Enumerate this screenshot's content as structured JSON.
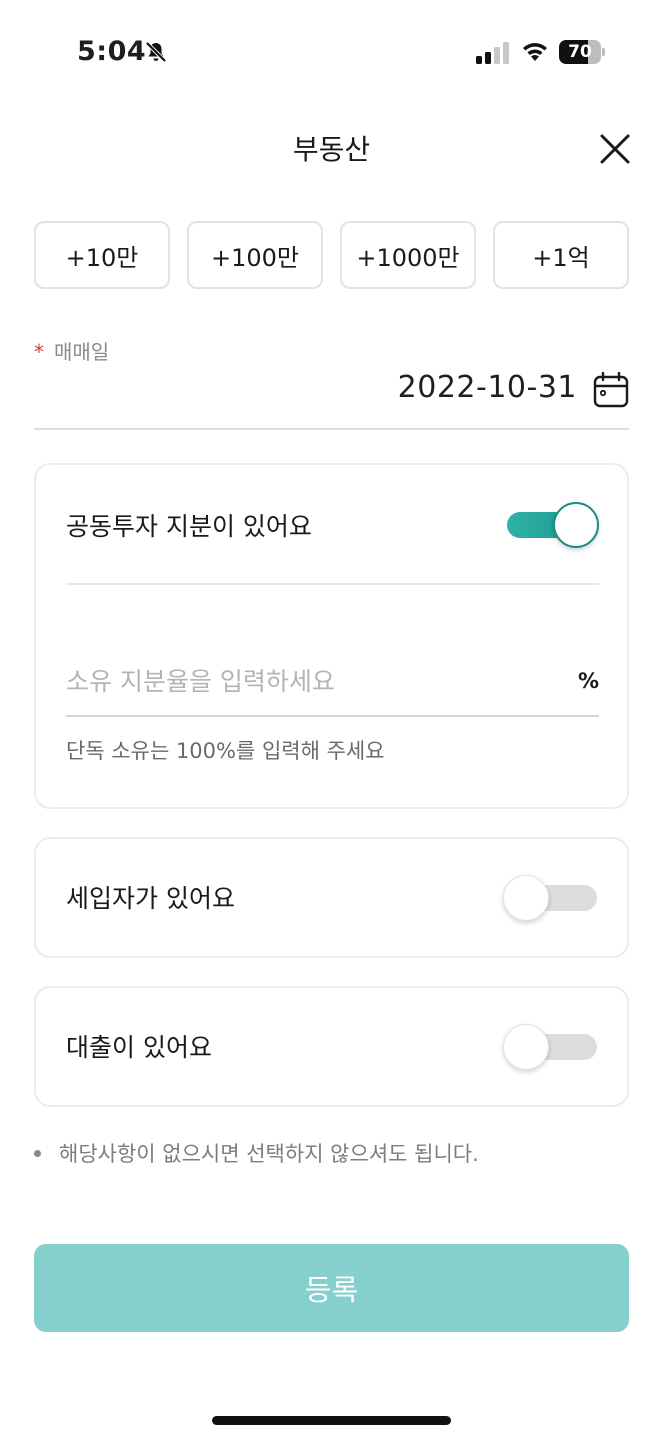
{
  "status_bar": {
    "time": "5:04",
    "battery_level": "70",
    "battery_fraction": 0.7,
    "icons": [
      "bell-slash-icon",
      "signal-icon",
      "wifi-icon",
      "battery-icon"
    ]
  },
  "header": {
    "title": "부동산",
    "close_icon": "close-icon"
  },
  "quick_amounts": [
    "+10만",
    "+100만",
    "+1000만",
    "+1억"
  ],
  "sale_date": {
    "required_mark": "*",
    "label": "매매일",
    "value": "2022-10-31",
    "icon": "calendar-icon"
  },
  "joint_investment": {
    "label": "공동투자 지분이 있어요",
    "enabled": true,
    "share_input": {
      "placeholder": "소유 지분율을 입력하세요",
      "value": "",
      "suffix": "%"
    },
    "helper_text": "단독 소유는 100%를 입력해 주세요"
  },
  "tenant": {
    "label": "세입자가 있어요",
    "enabled": false
  },
  "loan": {
    "label": "대출이 있어요",
    "enabled": false
  },
  "note": "해당사항이 없으시면 선택하지 않으셔도 됩니다.",
  "submit_label": "등록",
  "colors": {
    "accent": "#18958a",
    "submit_disabled": "#85cfcc",
    "required": "#e53935"
  }
}
